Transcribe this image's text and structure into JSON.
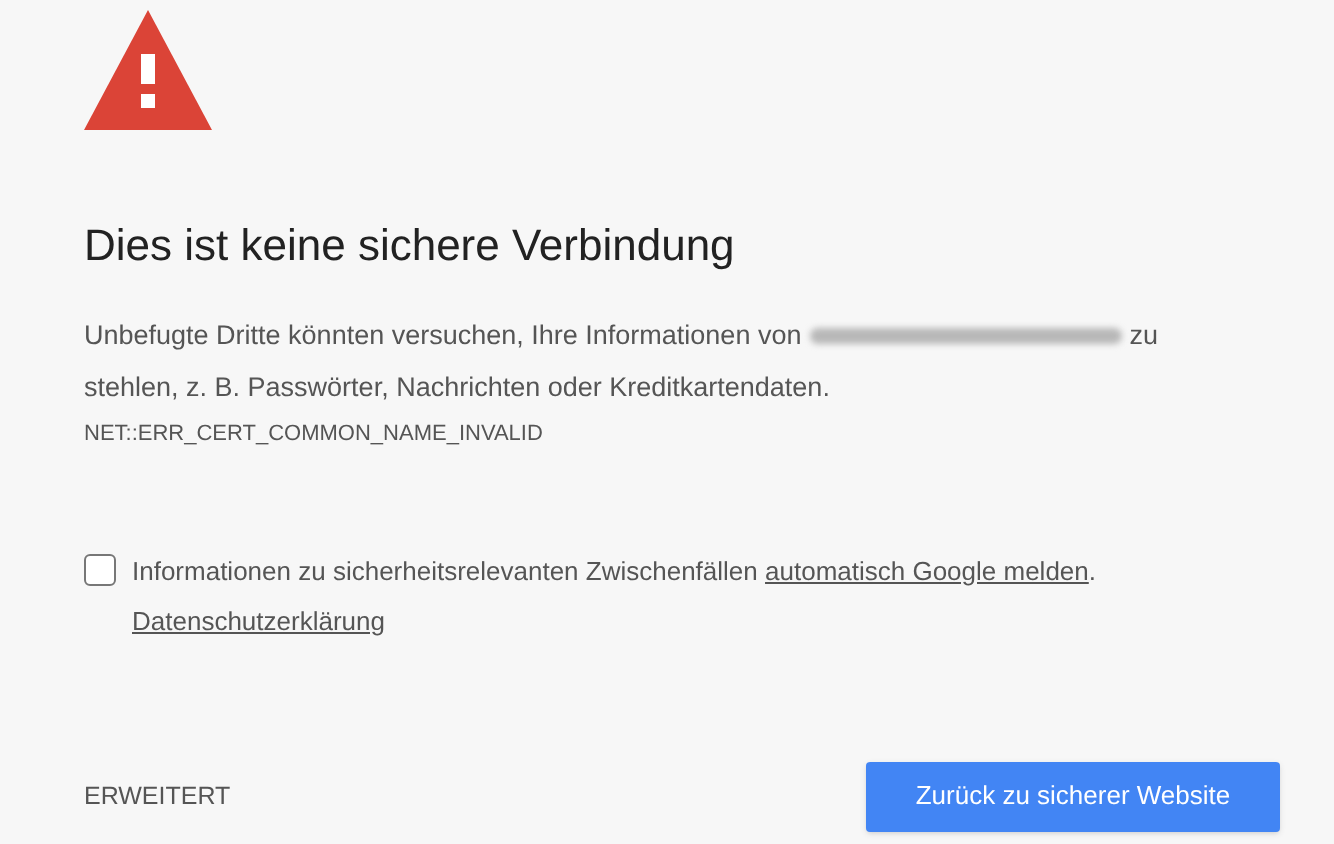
{
  "title": "Dies ist keine sichere Verbindung",
  "description": {
    "lead": "Unbefugte Dritte könnten versuchen, Ihre Informationen von",
    "site_name_redacted": true,
    "tail": "zu",
    "continuation": "stehlen, z. B. Passwörter, Nachrichten oder Kreditkartendaten."
  },
  "error_code": "NET::ERR_CERT_COMMON_NAME_INVALID",
  "report": {
    "checked": false,
    "text": "Informationen zu sicherheitsrelevanten Zwischenfällen",
    "link": "automatisch Google melden",
    "end": "."
  },
  "privacy_link": "Datenschutzerklärung",
  "advanced_button": "ERWEITERT",
  "back_button": "Zurück zu sicherer Website"
}
